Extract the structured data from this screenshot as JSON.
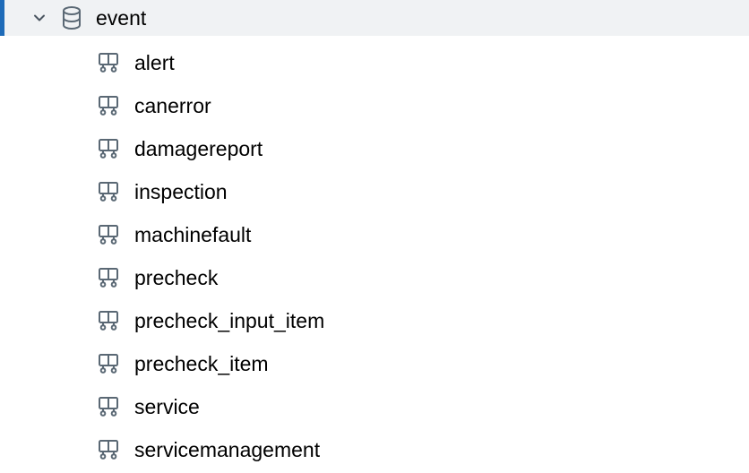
{
  "schema": {
    "name": "event",
    "expanded": true,
    "tables": [
      {
        "name": "alert"
      },
      {
        "name": "canerror"
      },
      {
        "name": "damagereport"
      },
      {
        "name": "inspection"
      },
      {
        "name": "machinefault"
      },
      {
        "name": "precheck"
      },
      {
        "name": "precheck_input_item"
      },
      {
        "name": "precheck_item"
      },
      {
        "name": "service"
      },
      {
        "name": "servicemanagement"
      }
    ]
  }
}
